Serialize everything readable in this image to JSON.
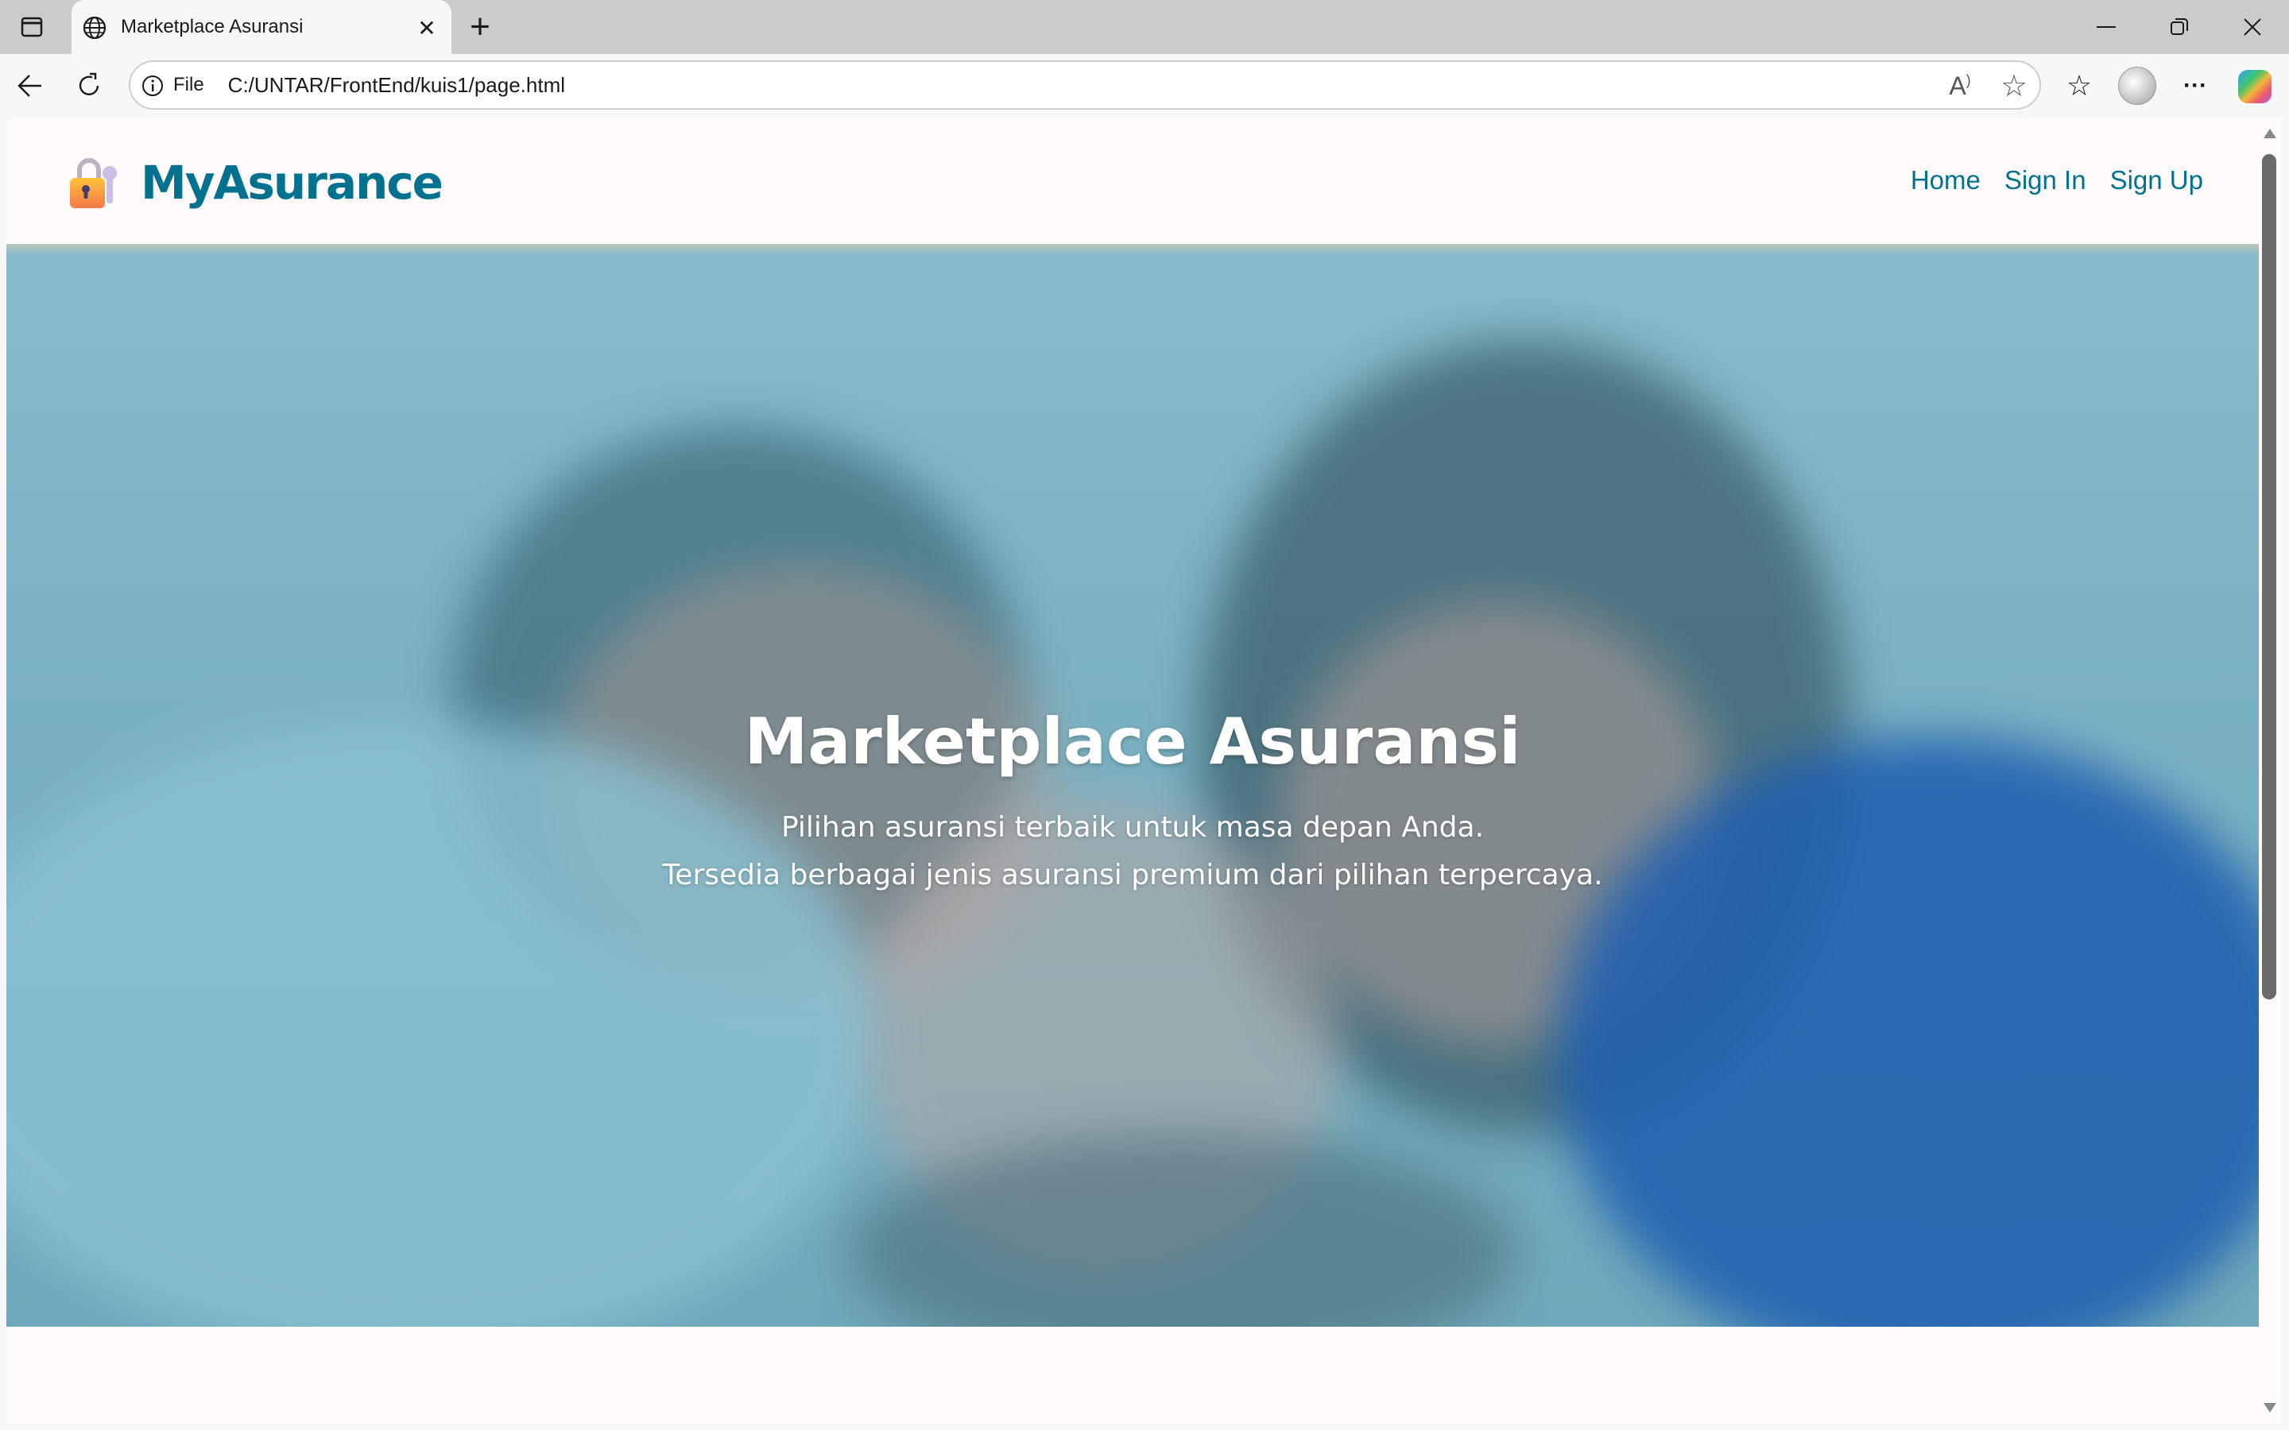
{
  "browser": {
    "tab_title": "Marketplace Asuransi",
    "address_prefix": "File",
    "url": "C:/UNTAR/FrontEnd/kuis1/page.html",
    "icons": [
      "sidebar-icon",
      "globe-icon",
      "close-icon",
      "new-tab-icon",
      "back-icon",
      "refresh-icon",
      "info-icon",
      "read-aloud-icon",
      "favorite-star-icon",
      "favorites-list-icon",
      "profile-avatar",
      "more-icon",
      "copilot-icon",
      "minimize-icon",
      "restore-icon",
      "window-close-icon"
    ]
  },
  "header": {
    "brand": "MyAsurance",
    "logo_icon": "lock-with-key-icon",
    "nav": [
      {
        "label": "Home"
      },
      {
        "label": "Sign In"
      },
      {
        "label": "Sign Up"
      }
    ]
  },
  "hero": {
    "title": "Marketplace Asuransi",
    "subtitle_line1": "Pilihan asuransi terbaik untuk masa depan Anda.",
    "subtitle_line2": "Tersedia berbagai jenis asuransi premium dari pilihan terpercaya.",
    "overlay_color": "#7db3c4"
  },
  "colors": {
    "brand": "#00728f",
    "accent_blue": "#1e5fb0"
  }
}
